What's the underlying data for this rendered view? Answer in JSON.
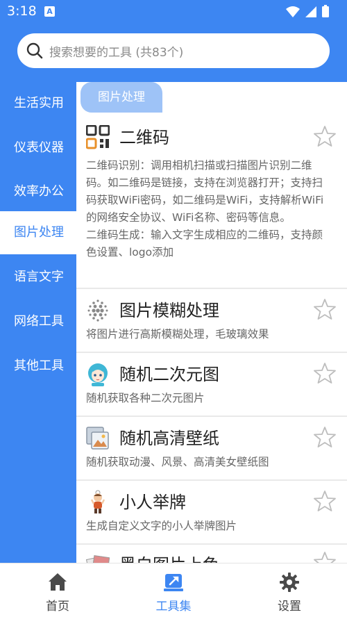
{
  "status_bar": {
    "time": "3:18",
    "notification_icon": "A",
    "icons": [
      "wifi-icon",
      "signal-icon",
      "battery-icon"
    ]
  },
  "search": {
    "placeholder": "搜索想要的工具 (共83个)"
  },
  "sidebar": {
    "items": [
      {
        "label": "生活实用",
        "active": false
      },
      {
        "label": "仪表仪器",
        "active": false
      },
      {
        "label": "效率办公",
        "active": false
      },
      {
        "label": "图片处理",
        "active": true
      },
      {
        "label": "语言文字",
        "active": false
      },
      {
        "label": "网络工具",
        "active": false
      },
      {
        "label": "其他工具",
        "active": false
      }
    ]
  },
  "section": {
    "title": "图片处理"
  },
  "tools": [
    {
      "title": "二维码",
      "icon": "qrcode-icon",
      "favorited": false,
      "desc": "二维码识别：调用相机扫描或扫描图片识别二维码。如二维码是链接，支持在浏览器打开；支持扫码获取WiFi密码，如二维码是WiFi，支持解析WiFi的网络安全协议、WiFi名称、密码等信息。\n二维码生成：输入文字生成相应的二维码，支持颜色设置、logo添加"
    },
    {
      "title": "图片模糊处理",
      "icon": "blur-dots-icon",
      "favorited": false,
      "desc": "将图片进行高斯模糊处理，毛玻璃效果"
    },
    {
      "title": "随机二次元图",
      "icon": "anime-girl-icon",
      "favorited": false,
      "desc": "随机获取各种二次元图片"
    },
    {
      "title": "随机高清壁纸",
      "icon": "wallpaper-icon",
      "favorited": false,
      "desc": "随机获取动漫、风景、高清美女壁纸图"
    },
    {
      "title": "小人举牌",
      "icon": "sign-holder-icon",
      "favorited": false,
      "desc": "生成自定义文字的小人举牌图片"
    },
    {
      "title": "黑白图片上色",
      "icon": "colorize-icon",
      "favorited": false,
      "desc": ""
    }
  ],
  "bottom_nav": {
    "items": [
      {
        "label": "首页",
        "icon": "home-icon",
        "active": false
      },
      {
        "label": "工具集",
        "icon": "toolbox-icon",
        "active": true
      },
      {
        "label": "设置",
        "icon": "gear-icon",
        "active": false
      }
    ]
  },
  "colors": {
    "primary": "#3d86f2",
    "chip": "#9ec3f7",
    "text": "#222222",
    "desc": "#666666"
  }
}
